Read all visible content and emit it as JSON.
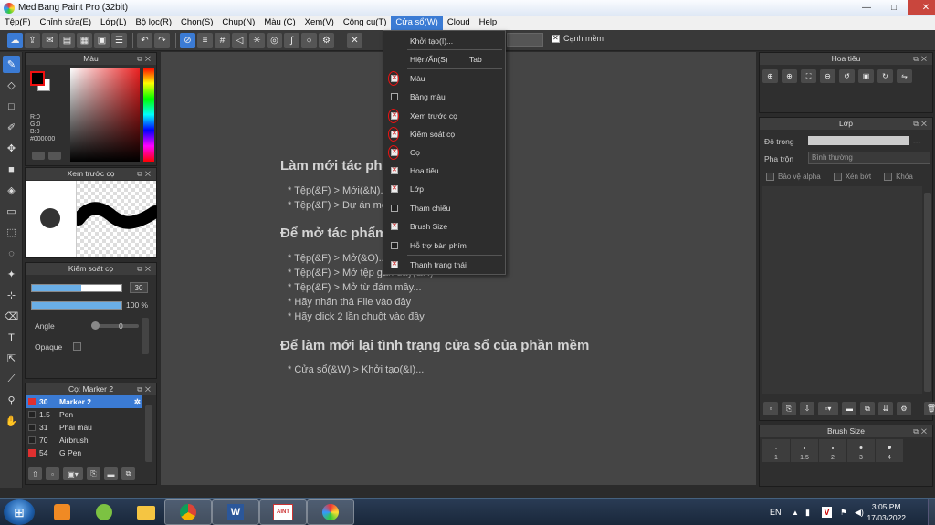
{
  "window": {
    "title": "MediBang Paint Pro (32bit)",
    "minimize": "—",
    "maximize": "□",
    "close": "✕"
  },
  "menubar": [
    "Tệp(F)",
    "Chỉnh sửa(E)",
    "Lớp(L)",
    "Bộ lọc(R)",
    "Chọn(S)",
    "Chụp(N)",
    "Màu (C)",
    "Xem(V)",
    "Công cụ(T)",
    "Cửa sổ(W)",
    "Cloud",
    "Help"
  ],
  "active_menu_index": 9,
  "toolbar": {
    "edge_label": "Cạnh mềm",
    "edge_checked": true
  },
  "panels": {
    "color": {
      "title": "Màu",
      "r": "R:0",
      "g": "G:0",
      "b": "B:0",
      "hex": "#000000",
      "fg_color": "#000000",
      "bg_color": "#ffffff"
    },
    "preview": {
      "title": "Xem trước cọ"
    },
    "control": {
      "title": "Kiểm soát cọ",
      "size_value": "30",
      "size_fill": 0.55,
      "opacity_value": "100 %",
      "opacity_fill": 1.0,
      "angle_label": "Angle",
      "angle_value": "0",
      "opaque_label": "Opaque"
    },
    "brush": {
      "title": "Cọ: Marker 2",
      "items": [
        {
          "size": "30",
          "name": "Marker 2",
          "color": "#e03030",
          "selected": true
        },
        {
          "size": "1.5",
          "name": "Pen",
          "color": "#222222",
          "selected": false
        },
        {
          "size": "31",
          "name": "Phai màu",
          "color": "#222222",
          "selected": false
        },
        {
          "size": "70",
          "name": "Airbrush",
          "color": "#222222",
          "selected": false
        },
        {
          "size": "54",
          "name": "G Pen",
          "color": "#e03030",
          "selected": false
        }
      ]
    },
    "navigator": {
      "title": "Hoa tiêu"
    },
    "layer": {
      "title": "Lớp",
      "opacity_label": "Độ trong",
      "opacity_value": "---",
      "blend_label": "Pha trộn",
      "blend_value": "Bình thường",
      "protect_alpha": "Bảo vệ alpha",
      "clipping": "Xén bớt",
      "lock": "Khóa"
    },
    "brush_size": {
      "title": "Brush Size",
      "values": [
        "1",
        "1.5",
        "2",
        "3",
        "4"
      ]
    }
  },
  "canvas_hints": {
    "new_title": "Làm mới tác phẩm",
    "new_lines": [
      "* Tệp(&F) > Mới(&N)...",
      "* Tệp(&F) > Dự án mới..."
    ],
    "open_title": "Để mở tác phẩm",
    "open_lines": [
      "* Tệp(&F) > Mở(&O)...",
      "* Tệp(&F) > Mở tệp gần đây(&R)",
      "* Tệp(&F) > Mở từ đám mây...",
      "* Hãy nhấn thả File vào đây",
      "* Hãy click 2 lần chuột vào đây"
    ],
    "reset_title": "Để làm mới lại tình trạng cửa sổ của phần mềm",
    "reset_lines": [
      "* Cửa sổ(&W) > Khởi tạo(&I)..."
    ]
  },
  "window_menu": {
    "items": [
      {
        "label": "Khởi tạo(I)...",
        "shortcut": "",
        "checkable": false,
        "checked": false,
        "circled": false
      },
      {
        "label": "Hiện/Ẩn(S)",
        "shortcut": "Tab",
        "checkable": false,
        "checked": false,
        "circled": false
      },
      {
        "label": "Màu",
        "shortcut": "",
        "checkable": true,
        "checked": true,
        "circled": true
      },
      {
        "label": "Bảng màu",
        "shortcut": "",
        "checkable": true,
        "checked": false,
        "circled": false
      },
      {
        "label": "Xem trước cọ",
        "shortcut": "",
        "checkable": true,
        "checked": true,
        "circled": true
      },
      {
        "label": "Kiểm soát cọ",
        "shortcut": "",
        "checkable": true,
        "checked": true,
        "circled": true
      },
      {
        "label": "Cọ",
        "shortcut": "",
        "checkable": true,
        "checked": true,
        "circled": true
      },
      {
        "label": "Hoa tiêu",
        "shortcut": "",
        "checkable": true,
        "checked": true,
        "circled": false
      },
      {
        "label": "Lớp",
        "shortcut": "",
        "checkable": true,
        "checked": true,
        "circled": false
      },
      {
        "label": "Tham chiếu",
        "shortcut": "",
        "checkable": true,
        "checked": false,
        "circled": false
      },
      {
        "label": "Brush Size",
        "shortcut": "",
        "checkable": true,
        "checked": true,
        "circled": false
      },
      {
        "label": "Hỗ trợ bàn phím",
        "shortcut": "",
        "checkable": true,
        "checked": false,
        "circled": false
      },
      {
        "label": "Thanh trạng thái",
        "shortcut": "",
        "checkable": true,
        "checked": true,
        "circled": false
      }
    ]
  },
  "taskbar": {
    "language": "EN",
    "time": "3:05 PM",
    "date": "17/03/2022",
    "apps": [
      "windows-media-player",
      "file-explorer",
      "chrome",
      "word",
      "medibang-paint",
      "medibang-paint-pro"
    ]
  },
  "colors": {
    "accent": "#3b7bd4",
    "panel_bg": "#2f2f2f",
    "canvas_bg": "#454545",
    "annotation_red": "#e11111"
  }
}
